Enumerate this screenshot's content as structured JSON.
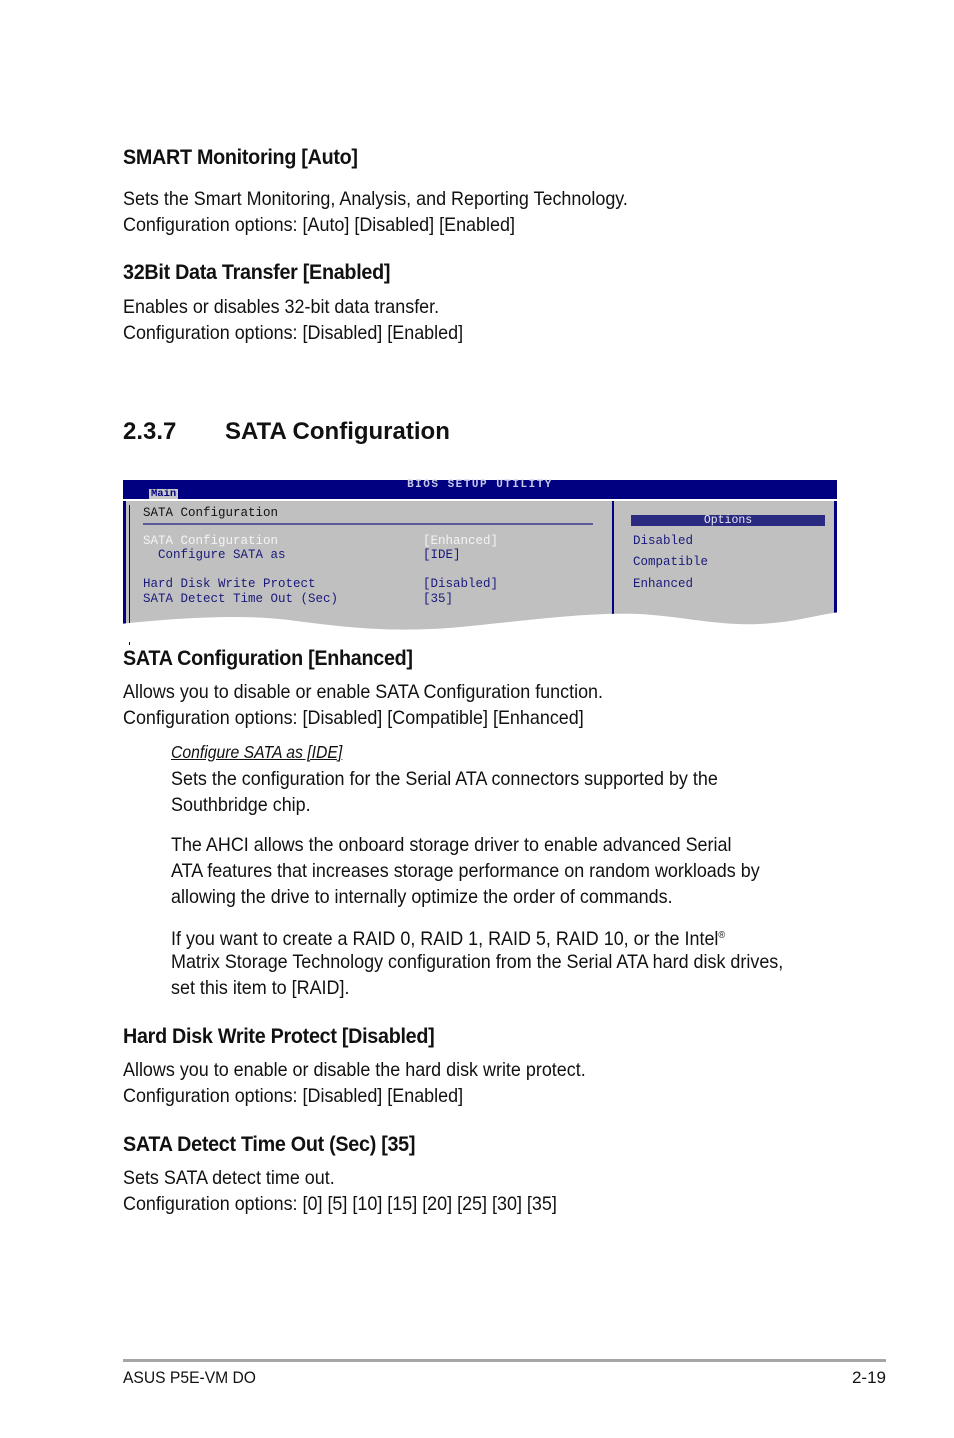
{
  "sections": {
    "smart": {
      "title": "SMART Monitoring [Auto]",
      "line1": "Sets the Smart Monitoring, Analysis, and Reporting Technology.",
      "line2": "Configuration options: [Auto] [Disabled] [Enabled]"
    },
    "bit32": {
      "title": "32Bit Data Transfer [Enabled]",
      "line1": "Enables or disables 32-bit data transfer.",
      "line2": "Configuration options: [Disabled] [Enabled]"
    },
    "heading": {
      "number": "2.3.7",
      "title": "SATA Configuration"
    },
    "sata_config": {
      "title": "SATA Configuration [Enhanced]",
      "line1": "Allows you to disable or enable SATA Configuration function.",
      "line2": "Configuration options: [Disabled] [Compatible] [Enhanced]",
      "sub": {
        "title": "Configure SATA as [IDE]",
        "p1_line1": "Sets the configuration for the Serial ATA connectors supported by the",
        "p1_line2": "Southbridge chip.",
        "p2_line1": "The AHCI allows the onboard storage driver to enable advanced Serial",
        "p2_line2": "ATA features that increases storage performance on random workloads by",
        "p2_line3": "allowing the drive to internally optimize the order of commands.",
        "p3_line1": "If you want to create a RAID 0, RAID 1,  RAID 5,  RAID 10, or the Intel",
        "p3_reg": "®",
        "p3_line2": "Matrix Storage Technology configuration from the Serial ATA hard disk drives,",
        "p3_line3": "set this item to [RAID]."
      }
    },
    "hdwp": {
      "title": "Hard Disk Write Protect [Disabled]",
      "line1": "Allows you to enable or disable the hard disk write protect.",
      "line2": "Configuration options: [Disabled] [Enabled]"
    },
    "timeout": {
      "title": "SATA Detect Time Out (Sec) [35]",
      "line1": "Sets SATA detect  time out.",
      "line2": "Configuration options: [0] [5] [10] [15] [20] [25] [30] [35]"
    }
  },
  "bios": {
    "title": "BIOS SETUP UTILITY",
    "tab": "Main",
    "heading": "SATA Configuration",
    "items": [
      {
        "label": "SATA Configuration",
        "value": "[Enhanced]",
        "selected": true
      },
      {
        "label": "  Configure SATA as",
        "value": "[IDE]",
        "selected": false
      },
      {
        "label": "Hard Disk Write Protect",
        "value": "[Disabled]",
        "selected": false
      },
      {
        "label": "SATA Detect Time Out (Sec)",
        "value": "[35]",
        "selected": false
      }
    ],
    "options_header": "Options",
    "options": [
      "Disabled",
      "Compatible",
      "Enhanced"
    ],
    "colors": {
      "bar": "#000080",
      "panel": "#c0c0c0",
      "text": "#1a1a7a",
      "selected_text": "#f4f4f4"
    }
  },
  "footer": {
    "left": "ASUS P5E-VM DO",
    "right": "2-19"
  }
}
